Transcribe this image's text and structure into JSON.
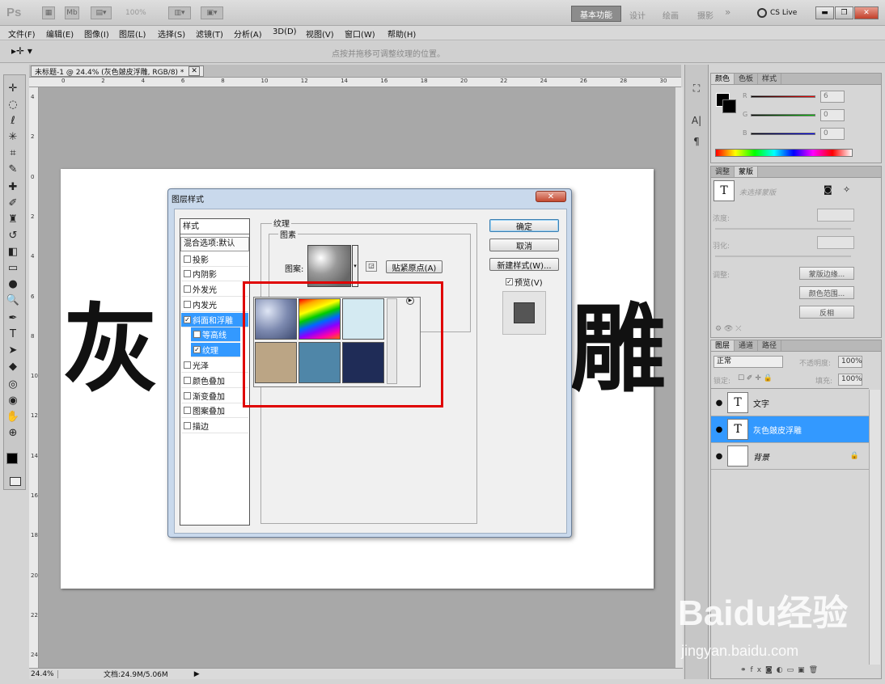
{
  "app": {
    "logo": "Ps",
    "zoom_dropdown": "100%",
    "cs_live": "CS Live"
  },
  "workspaces": {
    "active": "基本功能",
    "items": [
      "设计",
      "绘画",
      "摄影"
    ],
    "more": "»"
  },
  "menu": [
    "文件(F)",
    "编辑(E)",
    "图像(I)",
    "图层(L)",
    "选择(S)",
    "滤镜(T)",
    "分析(A)",
    "3D(D)",
    "视图(V)",
    "窗口(W)",
    "帮助(H)"
  ],
  "options": {
    "hint": "点按并拖移可调整纹理的位置。"
  },
  "document": {
    "tab_title": "未标题-1 @ 24.4% (灰色皴皮浮雕, RGB/8) *",
    "zoom": "24.4%",
    "doc_info": "文档:24.9M/5.06M",
    "text_left": "灰",
    "text_right": "雕",
    "ruler_top": [
      "0",
      "2",
      "4",
      "6",
      "8",
      "10",
      "12",
      "14",
      "16",
      "18",
      "20",
      "22",
      "24",
      "26",
      "28",
      "30"
    ],
    "ruler_left": [
      "4",
      "2",
      "0",
      "2",
      "4",
      "6",
      "8",
      "10",
      "12",
      "14",
      "16",
      "18",
      "20",
      "22",
      "24"
    ]
  },
  "dialog": {
    "title": "图层样式",
    "close": "✕",
    "styles_header": "样式",
    "blend_options": "混合选项:默认",
    "styles": [
      {
        "label": "投影",
        "checked": false
      },
      {
        "label": "内阴影",
        "checked": false
      },
      {
        "label": "外发光",
        "checked": false
      },
      {
        "label": "内发光",
        "checked": false
      },
      {
        "label": "斜面和浮雕",
        "checked": true
      },
      {
        "label": "等高线",
        "checked": false
      },
      {
        "label": "纹理",
        "checked": true
      },
      {
        "label": "光泽",
        "checked": false
      },
      {
        "label": "颜色叠加",
        "checked": false
      },
      {
        "label": "渐变叠加",
        "checked": false
      },
      {
        "label": "图案叠加",
        "checked": false
      },
      {
        "label": "描边",
        "checked": false
      }
    ],
    "texture_group": "纹理",
    "pattern_group": "图素",
    "pattern_label": "图案:",
    "snap_button": "贴紧原点(A)",
    "ok": "确定",
    "cancel": "取消",
    "new_style": "新建样式(W)...",
    "preview": "预览(V)"
  },
  "panels": {
    "color": {
      "tabs": [
        "颜色",
        "色板",
        "样式"
      ],
      "r_label": "R",
      "g_label": "G",
      "b_label": "B",
      "r": "6",
      "g": "0",
      "b": "0"
    },
    "adjust": {
      "tabs": [
        "调整",
        "蒙版"
      ],
      "no_selection": "未选择蒙版",
      "density": "浓度:",
      "feather": "羽化:",
      "refine": "调整:",
      "mask_edge": "蒙版边缘...",
      "color_range": "颜色范围...",
      "invert": "反相"
    },
    "layers": {
      "tabs": [
        "图层",
        "通道",
        "路径"
      ],
      "blend_mode": "正常",
      "opacity_label": "不透明度:",
      "opacity": "100%",
      "lock_label": "锁定:",
      "fill_label": "填充:",
      "fill": "100%",
      "items": [
        {
          "name": "文字",
          "type": "T"
        },
        {
          "name": "灰色皴皮浮雕",
          "type": "T"
        },
        {
          "name": "背景",
          "type": ""
        }
      ]
    }
  },
  "watermark": {
    "brand": "Baidu经验",
    "url": "jingyan.baidu.com"
  }
}
